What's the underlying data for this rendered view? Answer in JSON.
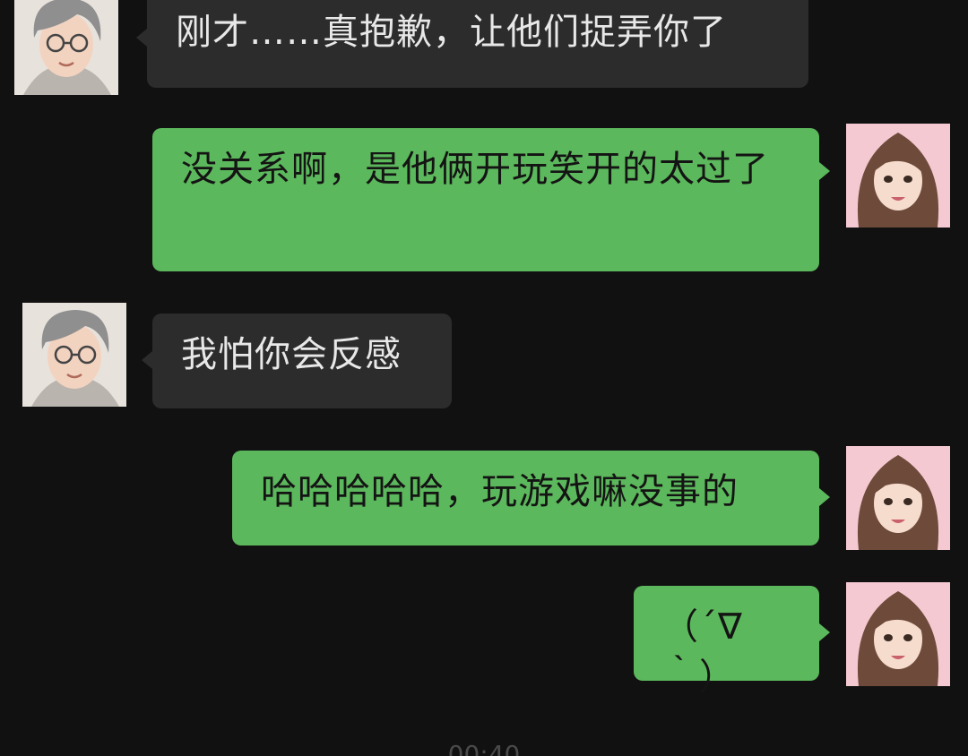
{
  "chat": {
    "messages": [
      {
        "sender": "male",
        "text": "刚才……真抱歉，让他们捉弄你了"
      },
      {
        "sender": "female",
        "text": "没关系啊，是他俩开玩笑开的太过了"
      },
      {
        "sender": "male",
        "text": "我怕你会反感"
      },
      {
        "sender": "female",
        "text": "哈哈哈哈哈，玩游戏嘛没事的"
      },
      {
        "sender": "female",
        "text": "（´∇｀）"
      }
    ],
    "timestamp": "00:40"
  },
  "colors": {
    "background": "#111111",
    "received_bubble": "#2c2c2c",
    "sent_bubble": "#5cb85c"
  },
  "icons": {
    "male_avatar": "avatar-male-glasses",
    "female_avatar": "avatar-female-long-hair"
  }
}
